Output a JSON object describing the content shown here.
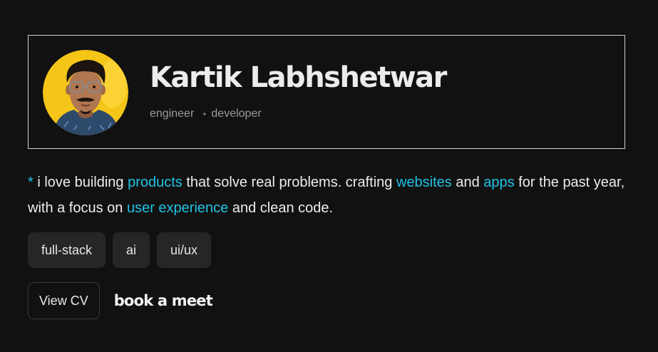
{
  "profile": {
    "name": "Kartik Labhshetwar",
    "roles": [
      "engineer",
      "developer"
    ],
    "role_separator": "•"
  },
  "bio": {
    "segments": [
      {
        "text": "* ",
        "highlight": true
      },
      {
        "text": "i love building ",
        "highlight": false
      },
      {
        "text": "products",
        "highlight": true
      },
      {
        "text": " that solve real problems. crafting ",
        "highlight": false
      },
      {
        "text": "websites",
        "highlight": true
      },
      {
        "text": " and ",
        "highlight": false
      },
      {
        "text": "apps",
        "highlight": true
      },
      {
        "text": " for the past year, with a focus on ",
        "highlight": false
      },
      {
        "text": "user experience",
        "highlight": true
      },
      {
        "text": " and clean code.",
        "highlight": false
      }
    ]
  },
  "tags": [
    "full-stack",
    "ai",
    "ui/ux"
  ],
  "actions": {
    "cv_label": "View CV",
    "meet_label": "book a meet"
  },
  "colors": {
    "background": "#111111",
    "accent": "#20c3e6",
    "avatar_background": "#f5c518",
    "tag_background": "#262626",
    "card_border": "#cfcfcf"
  }
}
